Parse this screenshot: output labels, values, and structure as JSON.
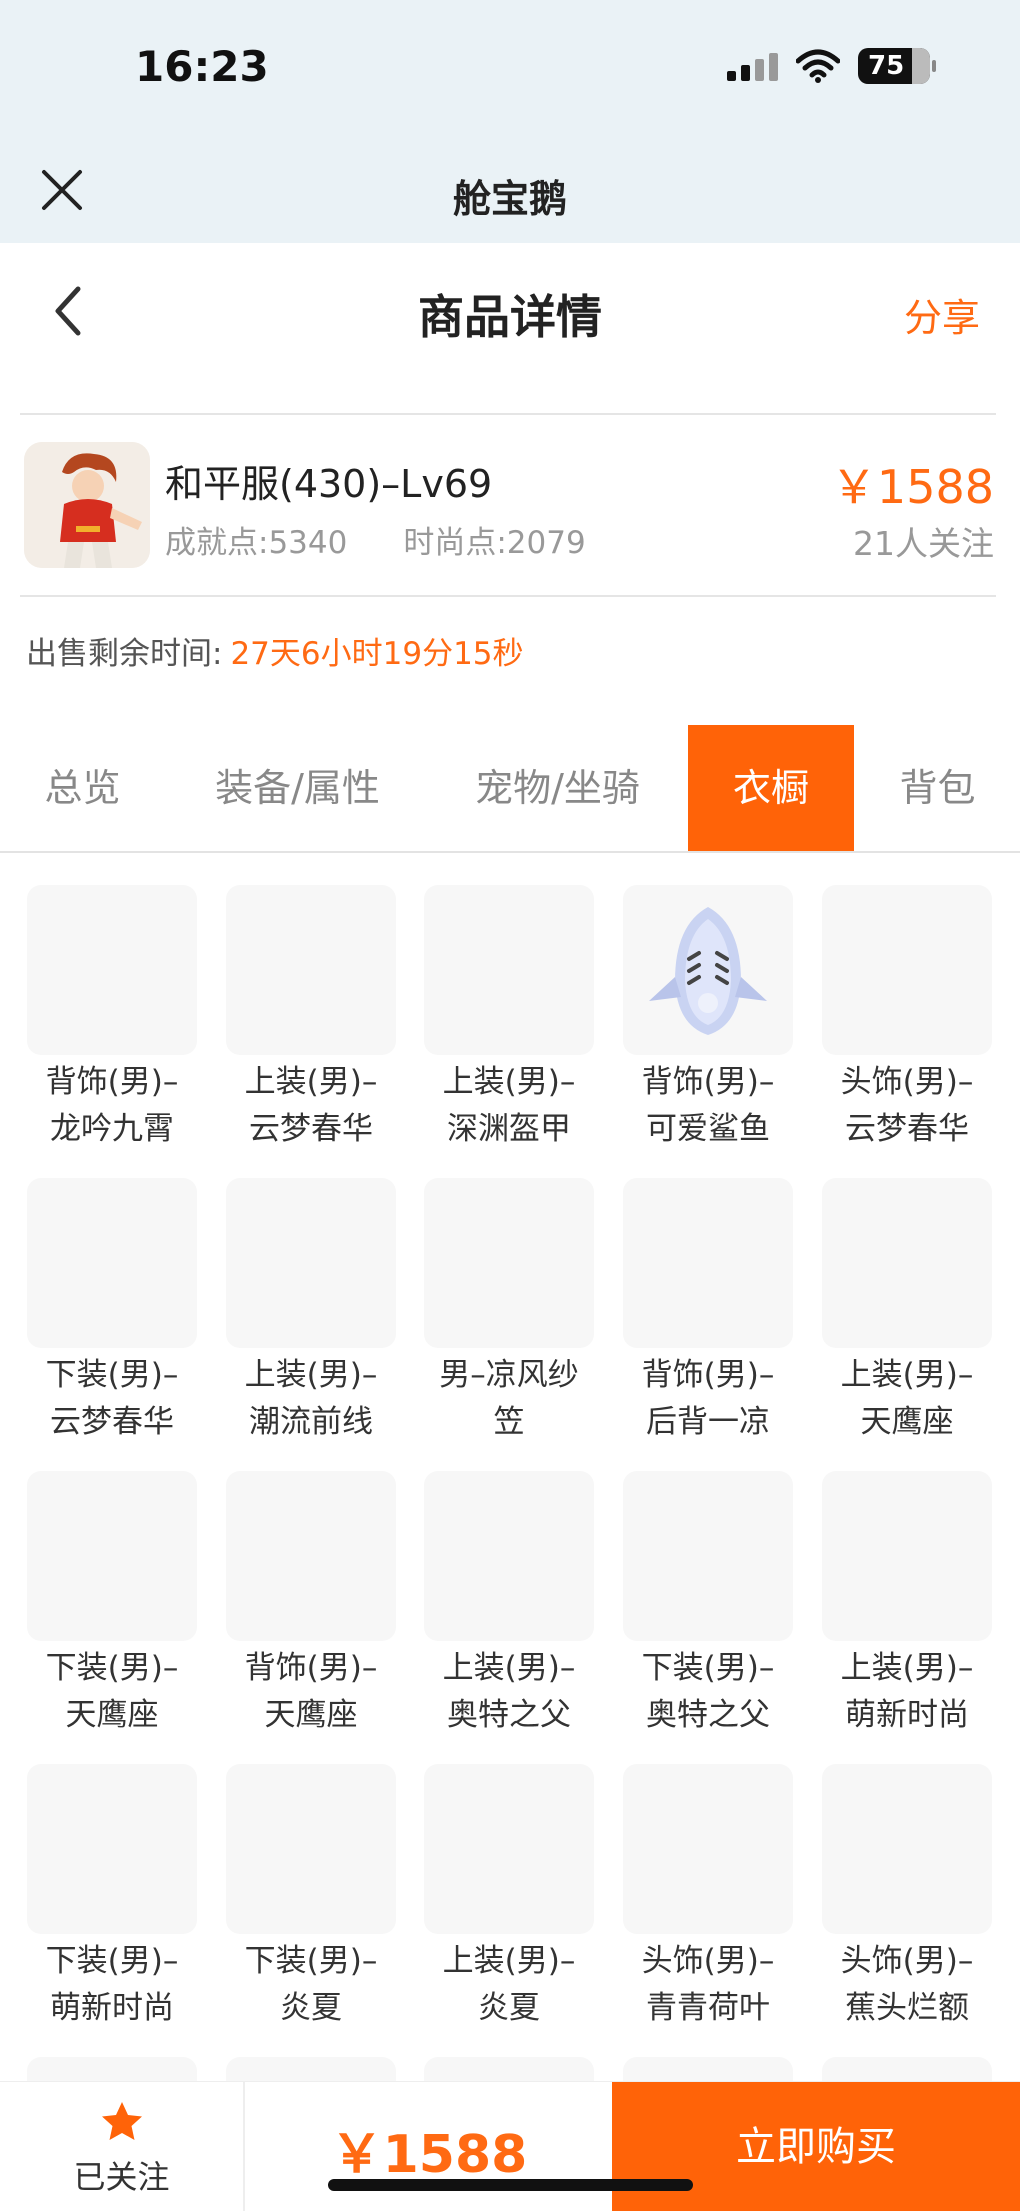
{
  "status_bar": {
    "time": "16:23",
    "battery": "75"
  },
  "mini_program": {
    "title": "舱宝鹅"
  },
  "header": {
    "title": "商品详情",
    "share_label": "分享"
  },
  "product": {
    "name": "和平服(430)–Lv69",
    "achievement": "成就点:5340",
    "fashion": "时尚点:2079",
    "price": "￥1588",
    "followers": "21人关注"
  },
  "sale": {
    "label": "出售剩余时间:",
    "remaining": "27天6小时19分15秒"
  },
  "tabs": [
    {
      "label": "总览",
      "active": false
    },
    {
      "label": "装备/属性",
      "active": false
    },
    {
      "label": "宠物/坐骑",
      "active": false
    },
    {
      "label": "衣橱",
      "active": true
    },
    {
      "label": "背包",
      "active": false
    }
  ],
  "wardrobe": [
    {
      "line1": "背饰(男)–",
      "line2": "龙吟九霄",
      "icon": ""
    },
    {
      "line1": "上装(男)–",
      "line2": "云梦春华",
      "icon": ""
    },
    {
      "line1": "上装(男)–",
      "line2": "深渊盔甲",
      "icon": ""
    },
    {
      "line1": "背饰(男)–",
      "line2": "可爱鲨鱼",
      "icon": "shark-icon"
    },
    {
      "line1": "头饰(男)–",
      "line2": "云梦春华",
      "icon": ""
    },
    {
      "line1": "下装(男)–",
      "line2": "云梦春华",
      "icon": ""
    },
    {
      "line1": "上装(男)–",
      "line2": "潮流前线",
      "icon": ""
    },
    {
      "line1": "男–凉风纱",
      "line2": "笠",
      "icon": ""
    },
    {
      "line1": "背饰(男)–",
      "line2": "后背一凉",
      "icon": ""
    },
    {
      "line1": "上装(男)–",
      "line2": "天鹰座",
      "icon": ""
    },
    {
      "line1": "下装(男)–",
      "line2": "天鹰座",
      "icon": ""
    },
    {
      "line1": "背饰(男)–",
      "line2": "天鹰座",
      "icon": ""
    },
    {
      "line1": "上装(男)–",
      "line2": "奥特之父",
      "icon": ""
    },
    {
      "line1": "下装(男)–",
      "line2": "奥特之父",
      "icon": ""
    },
    {
      "line1": "上装(男)–",
      "line2": "萌新时尚",
      "icon": ""
    },
    {
      "line1": "下装(男)–",
      "line2": "萌新时尚",
      "icon": ""
    },
    {
      "line1": "下装(男)–",
      "line2": "炎夏",
      "icon": ""
    },
    {
      "line1": "上装(男)–",
      "line2": "炎夏",
      "icon": ""
    },
    {
      "line1": "头饰(男)–",
      "line2": "青青荷叶",
      "icon": ""
    },
    {
      "line1": "头饰(男)–",
      "line2": "蕉头烂额",
      "icon": ""
    },
    {
      "line1": "",
      "line2": "",
      "icon": ""
    },
    {
      "line1": "",
      "line2": "",
      "icon": ""
    },
    {
      "line1": "",
      "line2": "",
      "icon": ""
    },
    {
      "line1": "",
      "line2": "",
      "icon": ""
    },
    {
      "line1": "",
      "line2": "",
      "icon": ""
    }
  ],
  "bottom_bar": {
    "follow_label": "已关注",
    "price": "￥1588",
    "buy_label": "立即购买"
  },
  "colors": {
    "accent": "#ff6308",
    "price": "#ff6a13"
  }
}
